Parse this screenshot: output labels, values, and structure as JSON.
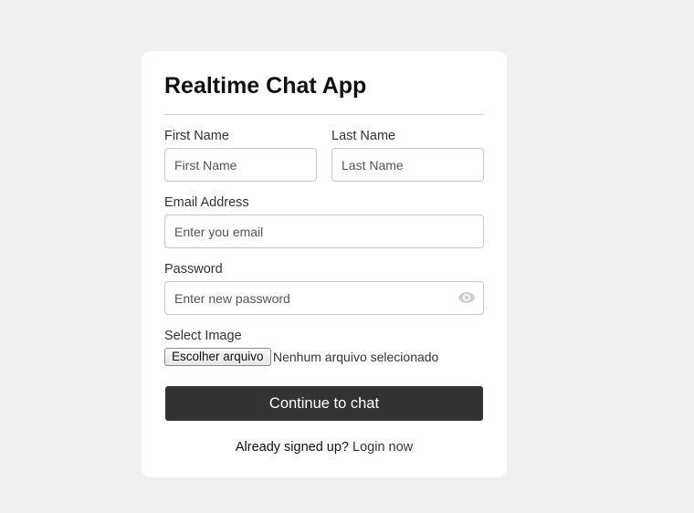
{
  "form": {
    "title": "Realtime Chat App",
    "first_name": {
      "label": "First Name",
      "placeholder": "First Name"
    },
    "last_name": {
      "label": "Last Name",
      "placeholder": "Last Name"
    },
    "email": {
      "label": "Email Address",
      "placeholder": "Enter you email"
    },
    "password": {
      "label": "Password",
      "placeholder": "Enter new password",
      "toggle_icon": "eye-icon"
    },
    "image": {
      "label": "Select Image",
      "button_label": "Escolher arquivo",
      "status": "Nenhum arquivo selecionado"
    },
    "submit_label": "Continue to chat",
    "footer_text": "Already signed up?",
    "footer_link": "Login now"
  },
  "colors": {
    "page_background": "#f0f0f0",
    "card_background": "#ffffff",
    "button_background": "#333333",
    "button_text": "#ffffff"
  }
}
